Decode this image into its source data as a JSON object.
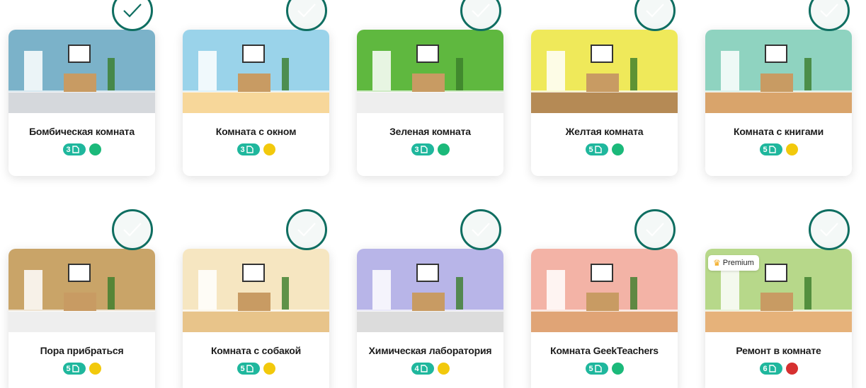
{
  "cards": [
    {
      "title": "Бомбическая комната",
      "pages": "3",
      "difficulty_color": "#1bb97a",
      "bg": "#7bb2c9",
      "floor": "#d5d8dc"
    },
    {
      "title": "Комната с окном",
      "pages": "3",
      "difficulty_color": "#f2c90c",
      "bg": "#9ad3ea",
      "floor": "#f7d79a"
    },
    {
      "title": "Зеленая комната",
      "pages": "3",
      "difficulty_color": "#1bb97a",
      "bg": "#5fb83f",
      "floor": "#eeeeee"
    },
    {
      "title": "Желтая комната",
      "pages": "5",
      "difficulty_color": "#1bb97a",
      "bg": "#efe95a",
      "floor": "#b58a55"
    },
    {
      "title": "Комната с книгами",
      "pages": "5",
      "difficulty_color": "#f2c90c",
      "bg": "#8fd3c0",
      "floor": "#d9a46b"
    },
    {
      "title": "Пора прибраться",
      "pages": "5",
      "difficulty_color": "#f2c90c",
      "bg": "#c9a468",
      "floor": "#eeeeee"
    },
    {
      "title": "Комната с собакой",
      "pages": "5",
      "difficulty_color": "#f2c90c",
      "bg": "#f6e6c1",
      "floor": "#e8c48a"
    },
    {
      "title": "Химическая лаборатория",
      "pages": "4",
      "difficulty_color": "#f2c90c",
      "bg": "#b8b5e8",
      "floor": "#dcdcdc"
    },
    {
      "title": "Комната GeekTeachers",
      "pages": "5",
      "difficulty_color": "#1bb97a",
      "bg": "#f3b3a6",
      "floor": "#e0a476"
    },
    {
      "title": "Ремонт в комнате",
      "pages": "6",
      "difficulty_color": "#d63030",
      "bg": "#b7d88a",
      "floor": "#e6b27a",
      "badge": "Premium"
    }
  ]
}
